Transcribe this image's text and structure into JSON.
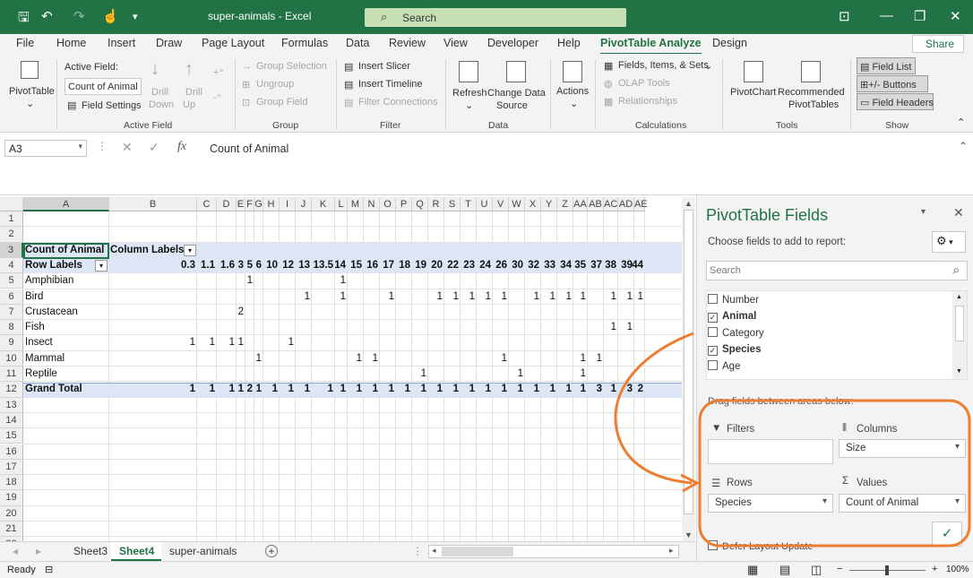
{
  "titlebar": {
    "title": "super-animals  -  Excel",
    "search_label": "Search"
  },
  "menu": {
    "items": [
      "File",
      "Home",
      "Insert",
      "Draw",
      "Page Layout",
      "Formulas",
      "Data",
      "Review",
      "View",
      "Developer",
      "Help",
      "PivotTable Analyze",
      "Design"
    ],
    "share": "Share"
  },
  "ribbon": {
    "pivottable": "PivotTable",
    "active_field_label": "Active Field:",
    "active_field_value": "Count of Animal",
    "field_settings": "Field Settings",
    "drill_down_1": "Drill",
    "drill_down_2": "Down",
    "drill_up_1": "Drill",
    "drill_up_2": "Up",
    "group_selection": "Group Selection",
    "ungroup": "Ungroup",
    "group_field": "Group Field",
    "insert_slicer": "Insert Slicer",
    "insert_timeline": "Insert Timeline",
    "filter_connections": "Filter Connections",
    "refresh": "Refresh",
    "change_data_1": "Change Data",
    "change_data_2": "Source",
    "actions": "Actions",
    "fields_items": "Fields, Items, & Sets",
    "olap": "OLAP Tools",
    "relationships": "Relationships",
    "pivotchart": "PivotChart",
    "recommended_1": "Recommended",
    "recommended_2": "PivotTables",
    "field_list": "Field List",
    "buttons": "+/- Buttons",
    "field_headers": "Field Headers",
    "groups": [
      "Active Field",
      "Group",
      "Filter",
      "Data",
      "Calculations",
      "Tools",
      "Show"
    ]
  },
  "formula": {
    "namebox": "A3",
    "content": "Count of Animal",
    "fx": "fx"
  },
  "grid": {
    "columns": [
      "A",
      "B",
      "C",
      "D",
      "E",
      "F",
      "G",
      "H",
      "I",
      "J",
      "K",
      "L",
      "M",
      "N",
      "O",
      "P",
      "Q",
      "R",
      "S",
      "T",
      "U",
      "V",
      "W",
      "X",
      "Y",
      "Z",
      "AA",
      "AB",
      "AC",
      "AD",
      "AE"
    ],
    "rows": [
      "1",
      "2",
      "3",
      "4",
      "5",
      "6",
      "7",
      "8",
      "9",
      "10",
      "11",
      "12",
      "13",
      "14",
      "15",
      "16",
      "17",
      "18",
      "19",
      "20",
      "21",
      "22"
    ],
    "count_label": "Count of Animal",
    "column_labels": "Column Labels",
    "row_labels": "Row Labels",
    "col_values": [
      "0.3",
      "1.1",
      "1.6",
      "3",
      "5",
      "6",
      "10",
      "12",
      "13",
      "13.5",
      "14",
      "15",
      "16",
      "17",
      "18",
      "19",
      "20",
      "22",
      "23",
      "24",
      "26",
      "30",
      "32",
      "33",
      "34",
      "35",
      "37",
      "38",
      "39",
      "44"
    ],
    "categories": [
      "Amphibian",
      "Bird",
      "Crustacean",
      "Fish",
      "Insect",
      "Mammal",
      "Reptile"
    ],
    "grand_total": "Grand Total",
    "cells": [
      {
        "r": 0,
        "vals": [
          [
            "5",
            "1"
          ],
          [
            "14",
            "1"
          ]
        ]
      },
      {
        "r": 1,
        "vals": [
          [
            "13",
            "1"
          ],
          [
            "14",
            "1"
          ],
          [
            "17",
            "1"
          ],
          [
            "20",
            "1"
          ],
          [
            "22",
            "1"
          ],
          [
            "23",
            "1"
          ],
          [
            "24",
            "1"
          ],
          [
            "26",
            "1"
          ],
          [
            "32",
            "1"
          ],
          [
            "33",
            "1"
          ],
          [
            "34",
            "1"
          ],
          [
            "35",
            "1"
          ],
          [
            "38",
            "1"
          ],
          [
            "39",
            "1"
          ],
          [
            "44",
            "1"
          ]
        ]
      },
      {
        "r": 2,
        "vals": [
          [
            "3",
            "2"
          ]
        ]
      },
      {
        "r": 3,
        "vals": [
          [
            "38",
            "1"
          ],
          [
            "39",
            "1"
          ]
        ]
      },
      {
        "r": 4,
        "vals": [
          [
            "0.3",
            "1"
          ],
          [
            "1.1",
            "1"
          ],
          [
            "1.6",
            "1"
          ],
          [
            "3",
            "1"
          ],
          [
            "12",
            "1"
          ]
        ]
      },
      {
        "r": 5,
        "vals": [
          [
            "6",
            "1"
          ],
          [
            "15",
            "1"
          ],
          [
            "16",
            "1"
          ],
          [
            "26",
            "1"
          ],
          [
            "35",
            "1"
          ],
          [
            "37",
            "1"
          ]
        ]
      },
      {
        "r": 6,
        "vals": [
          [
            "19",
            "1"
          ],
          [
            "30",
            "1"
          ],
          [
            "35",
            "1"
          ]
        ]
      }
    ],
    "totals": [
      "1",
      "1",
      "1",
      "1",
      "2",
      "1",
      "1",
      "1",
      "1",
      "1",
      "1",
      "1",
      "1",
      "1",
      "1",
      "1",
      "1",
      "1",
      "1",
      "1",
      "1",
      "1",
      "1",
      "1",
      "1",
      "1",
      "3",
      "1",
      "3",
      "2",
      "1"
    ]
  },
  "sheets": {
    "tabs": [
      "Sheet3",
      "Sheet4",
      "super-animals"
    ],
    "active": "Sheet4"
  },
  "status": {
    "ready": "Ready",
    "zoom": "100%"
  },
  "pane": {
    "title": "PivotTable Fields",
    "choose": "Choose fields to add to report:",
    "search_placeholder": "Search",
    "fields": [
      {
        "name": "Number",
        "checked": false
      },
      {
        "name": "Animal",
        "checked": true
      },
      {
        "name": "Category",
        "checked": false
      },
      {
        "name": "Species",
        "checked": true
      },
      {
        "name": "Age",
        "checked": false
      }
    ],
    "drag_hint": "Drag fields between areas below:",
    "filters": "Filters",
    "columns": "Columns",
    "rows": "Rows",
    "values": "Values",
    "columns_value": "Size",
    "rows_value": "Species",
    "values_value": "Count of Animal",
    "defer": "Defer Layout Update"
  },
  "colors": {
    "accent": "#217346",
    "annotation": "#ed7d31",
    "pivot_header": "#dce6f4"
  }
}
